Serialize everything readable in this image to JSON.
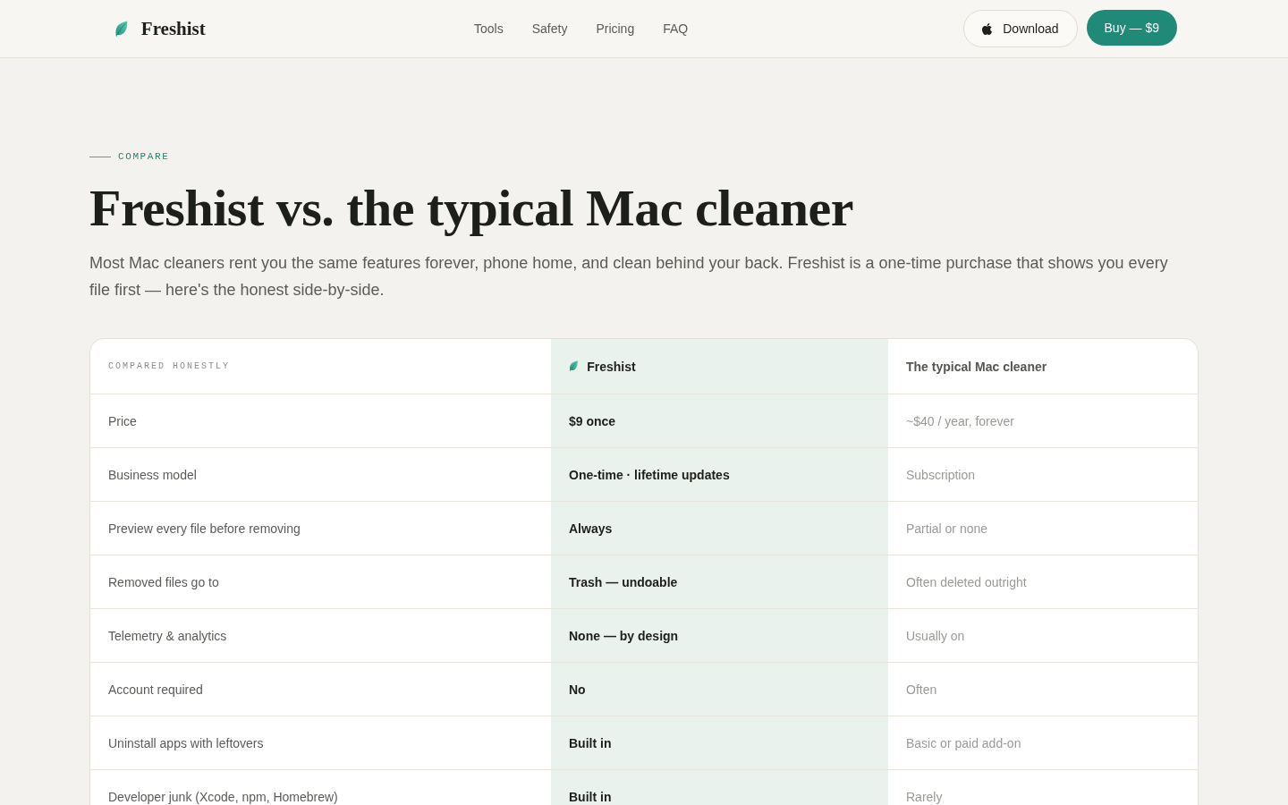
{
  "nav": {
    "brand": "Freshist",
    "links": [
      "Tools",
      "Safety",
      "Pricing",
      "FAQ"
    ],
    "download_button": "Download",
    "buy_button": "Buy — $9"
  },
  "section": {
    "eyebrow": "COMPARE",
    "title": "Freshist vs. the typical Mac cleaner",
    "intro": "Most Mac cleaners rent you the same features forever, phone home, and clean behind your back. Freshist is a one-time purchase that shows you every file first — here's the honest side-by-side."
  },
  "table": {
    "columns": [
      {
        "label": "COMPARED HONESTLY",
        "kind": "caption"
      },
      {
        "label": "Freshist",
        "kind": "product"
      },
      {
        "label": "The typical Mac cleaner",
        "kind": "other"
      }
    ],
    "rows": [
      {
        "cells": [
          "Price",
          "$9 once",
          "~$40 / year, forever"
        ]
      },
      {
        "cells": [
          "Business model",
          "One-time · lifetime updates",
          "Subscription"
        ]
      },
      {
        "cells": [
          "Preview every file before removing",
          "Always",
          "Partial or none"
        ]
      },
      {
        "cells": [
          "Removed files go to",
          "Trash — undoable",
          "Often deleted outright"
        ]
      },
      {
        "cells": [
          "Telemetry & analytics",
          "None — by design",
          "Usually on"
        ]
      },
      {
        "cells": [
          "Account required",
          "No",
          "Often"
        ]
      },
      {
        "cells": [
          "Uninstall apps with leftovers",
          "Built in",
          "Basic or paid add-on"
        ]
      },
      {
        "cells": [
          "Developer junk (Xcode, npm, Homebrew)",
          "Built in",
          "Rarely"
        ]
      }
    ]
  }
}
